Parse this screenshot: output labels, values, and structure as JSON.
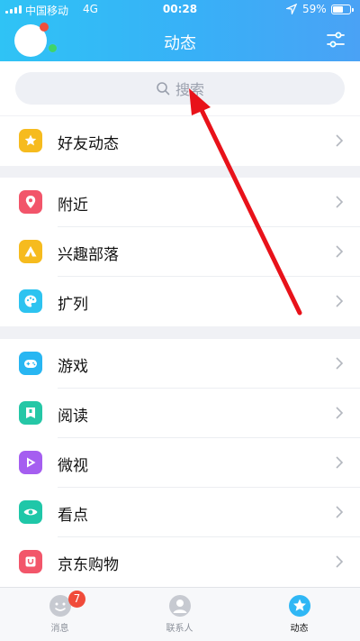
{
  "status_bar": {
    "carrier": "中国移动",
    "network": "4G",
    "time": "00:28",
    "battery": "59%",
    "battery_level": 0.59
  },
  "header": {
    "title": "动态",
    "settings_icon": "sliders-icon"
  },
  "search": {
    "placeholder": "搜索",
    "icon": "search-icon"
  },
  "groups": [
    [
      {
        "label": "好友动态",
        "icon": "star-icon",
        "color": "#f6bb1e"
      }
    ],
    [
      {
        "label": "附近",
        "icon": "location-pin-icon",
        "color": "#f2556a"
      },
      {
        "label": "兴趣部落",
        "icon": "tent-icon",
        "color": "#f6bb1e"
      },
      {
        "label": "扩列",
        "icon": "palette-icon",
        "color": "#2dc3f0"
      }
    ],
    [
      {
        "label": "游戏",
        "icon": "gamepad-icon",
        "color": "#28b6f2"
      },
      {
        "label": "阅读",
        "icon": "book-icon",
        "color": "#25c7a6"
      },
      {
        "label": "微视",
        "icon": "play-icon",
        "color": "#a55ef0"
      },
      {
        "label": "看点",
        "icon": "eye-icon",
        "color": "#1fc7a8"
      },
      {
        "label": "京东购物",
        "icon": "shopping-bag-icon",
        "color": "#f2566a"
      }
    ]
  ],
  "tabbar": {
    "messages": {
      "label": "消息",
      "badge": "7"
    },
    "contacts": {
      "label": "联系人"
    },
    "moments": {
      "label": "动态"
    }
  }
}
